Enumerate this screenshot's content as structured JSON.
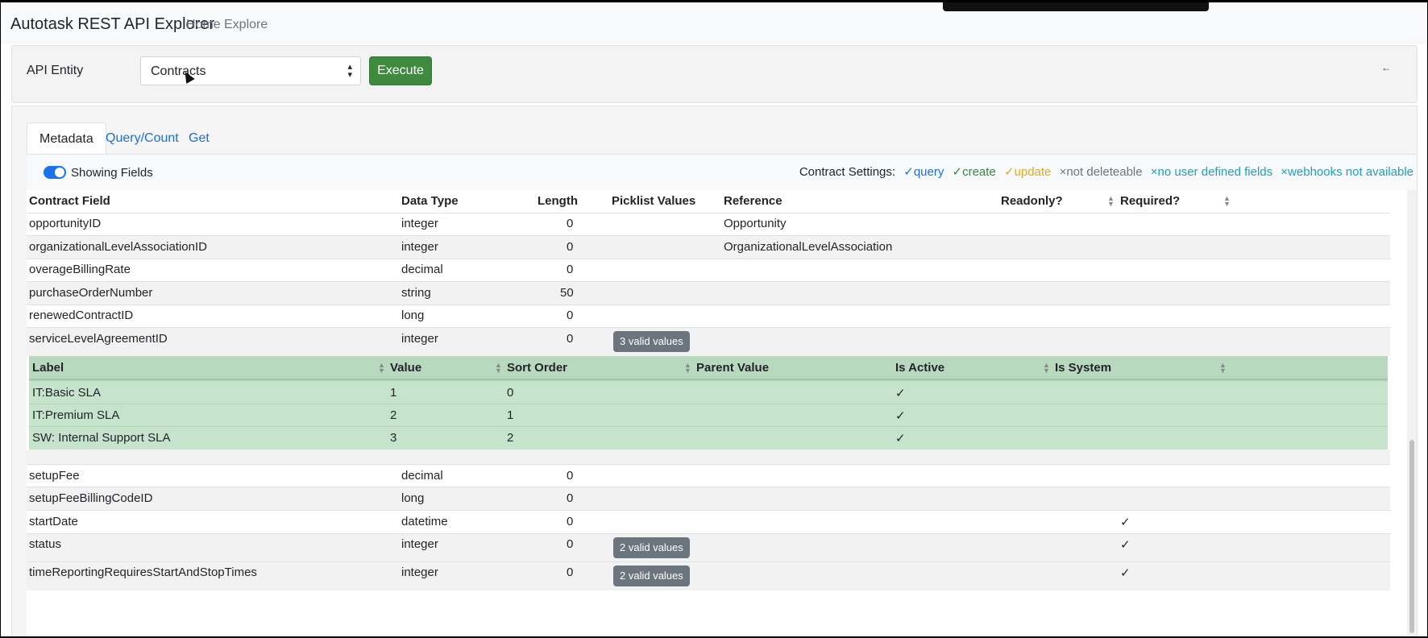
{
  "app": {
    "title": "Autotask REST API Explorer",
    "nav": [
      "Home",
      "Explore"
    ]
  },
  "entity_bar": {
    "label": "API Entity",
    "select_value": "Contracts",
    "execute_label": "Execute",
    "collapse_icon": "arrow-left-icon"
  },
  "tabs": [
    {
      "label": "Metadata",
      "active": true
    },
    {
      "label": "Query/Count",
      "active": false
    },
    {
      "label": "Get",
      "active": false
    }
  ],
  "settings": {
    "toggle_label": "Showing Fields",
    "title": "Contract Settings:",
    "query": "✓query",
    "create": "✓create",
    "update": "✓update",
    "delete": "×not deleteable",
    "udf": "×no user defined fields",
    "webhooks": "×webhooks not available"
  },
  "fields_table": {
    "headers": [
      "Contract Field",
      "Data Type",
      "Length",
      "Picklist Values",
      "Reference",
      "Readonly?",
      "Required?"
    ],
    "rows_top": [
      {
        "field": "opportunityID",
        "type": "integer",
        "length": "0",
        "picklist": "",
        "reference": "Opportunity",
        "required": ""
      },
      {
        "field": "organizationalLevelAssociationID",
        "type": "integer",
        "length": "0",
        "picklist": "",
        "reference": "OrganizationalLevelAssociation",
        "required": ""
      },
      {
        "field": "overageBillingRate",
        "type": "decimal",
        "length": "0",
        "picklist": "",
        "reference": "",
        "required": ""
      },
      {
        "field": "purchaseOrderNumber",
        "type": "string",
        "length": "50",
        "picklist": "",
        "reference": "",
        "required": ""
      },
      {
        "field": "renewedContractID",
        "type": "long",
        "length": "0",
        "picklist": "",
        "reference": "",
        "required": ""
      },
      {
        "field": "serviceLevelAgreementID",
        "type": "integer",
        "length": "0",
        "picklist": "3 valid values",
        "reference": "",
        "required": ""
      }
    ],
    "rows_bottom": [
      {
        "field": "setupFee",
        "type": "decimal",
        "length": "0",
        "picklist": "",
        "reference": "",
        "required": ""
      },
      {
        "field": "setupFeeBillingCodeID",
        "type": "long",
        "length": "0",
        "picklist": "",
        "reference": "",
        "required": ""
      },
      {
        "field": "startDate",
        "type": "datetime",
        "length": "0",
        "picklist": "",
        "reference": "",
        "required": "✓"
      },
      {
        "field": "status",
        "type": "integer",
        "length": "0",
        "picklist": "2 valid values",
        "reference": "",
        "required": "✓"
      },
      {
        "field": "timeReportingRequiresStartAndStopTimes",
        "type": "integer",
        "length": "0",
        "picklist": "2 valid values",
        "reference": "",
        "required": "✓"
      }
    ]
  },
  "picklist_table": {
    "headers": [
      "Label",
      "Value",
      "Sort Order",
      "Parent Value",
      "Is Active",
      "Is System"
    ],
    "rows": [
      {
        "label": "IT:Basic SLA",
        "value": "1",
        "sort": "0",
        "parent": "",
        "active": "✓",
        "system": ""
      },
      {
        "label": "IT:Premium SLA",
        "value": "2",
        "sort": "1",
        "parent": "",
        "active": "✓",
        "system": ""
      },
      {
        "label": "SW: Internal Support SLA",
        "value": "3",
        "sort": "2",
        "parent": "",
        "active": "✓",
        "system": ""
      }
    ]
  },
  "colors": {
    "execute": "#3f8a3f",
    "link": "#1a6fe0",
    "toggle": "#1a73e8",
    "picklist_bg": "#c6e3cb",
    "badge": "#6c757d"
  }
}
